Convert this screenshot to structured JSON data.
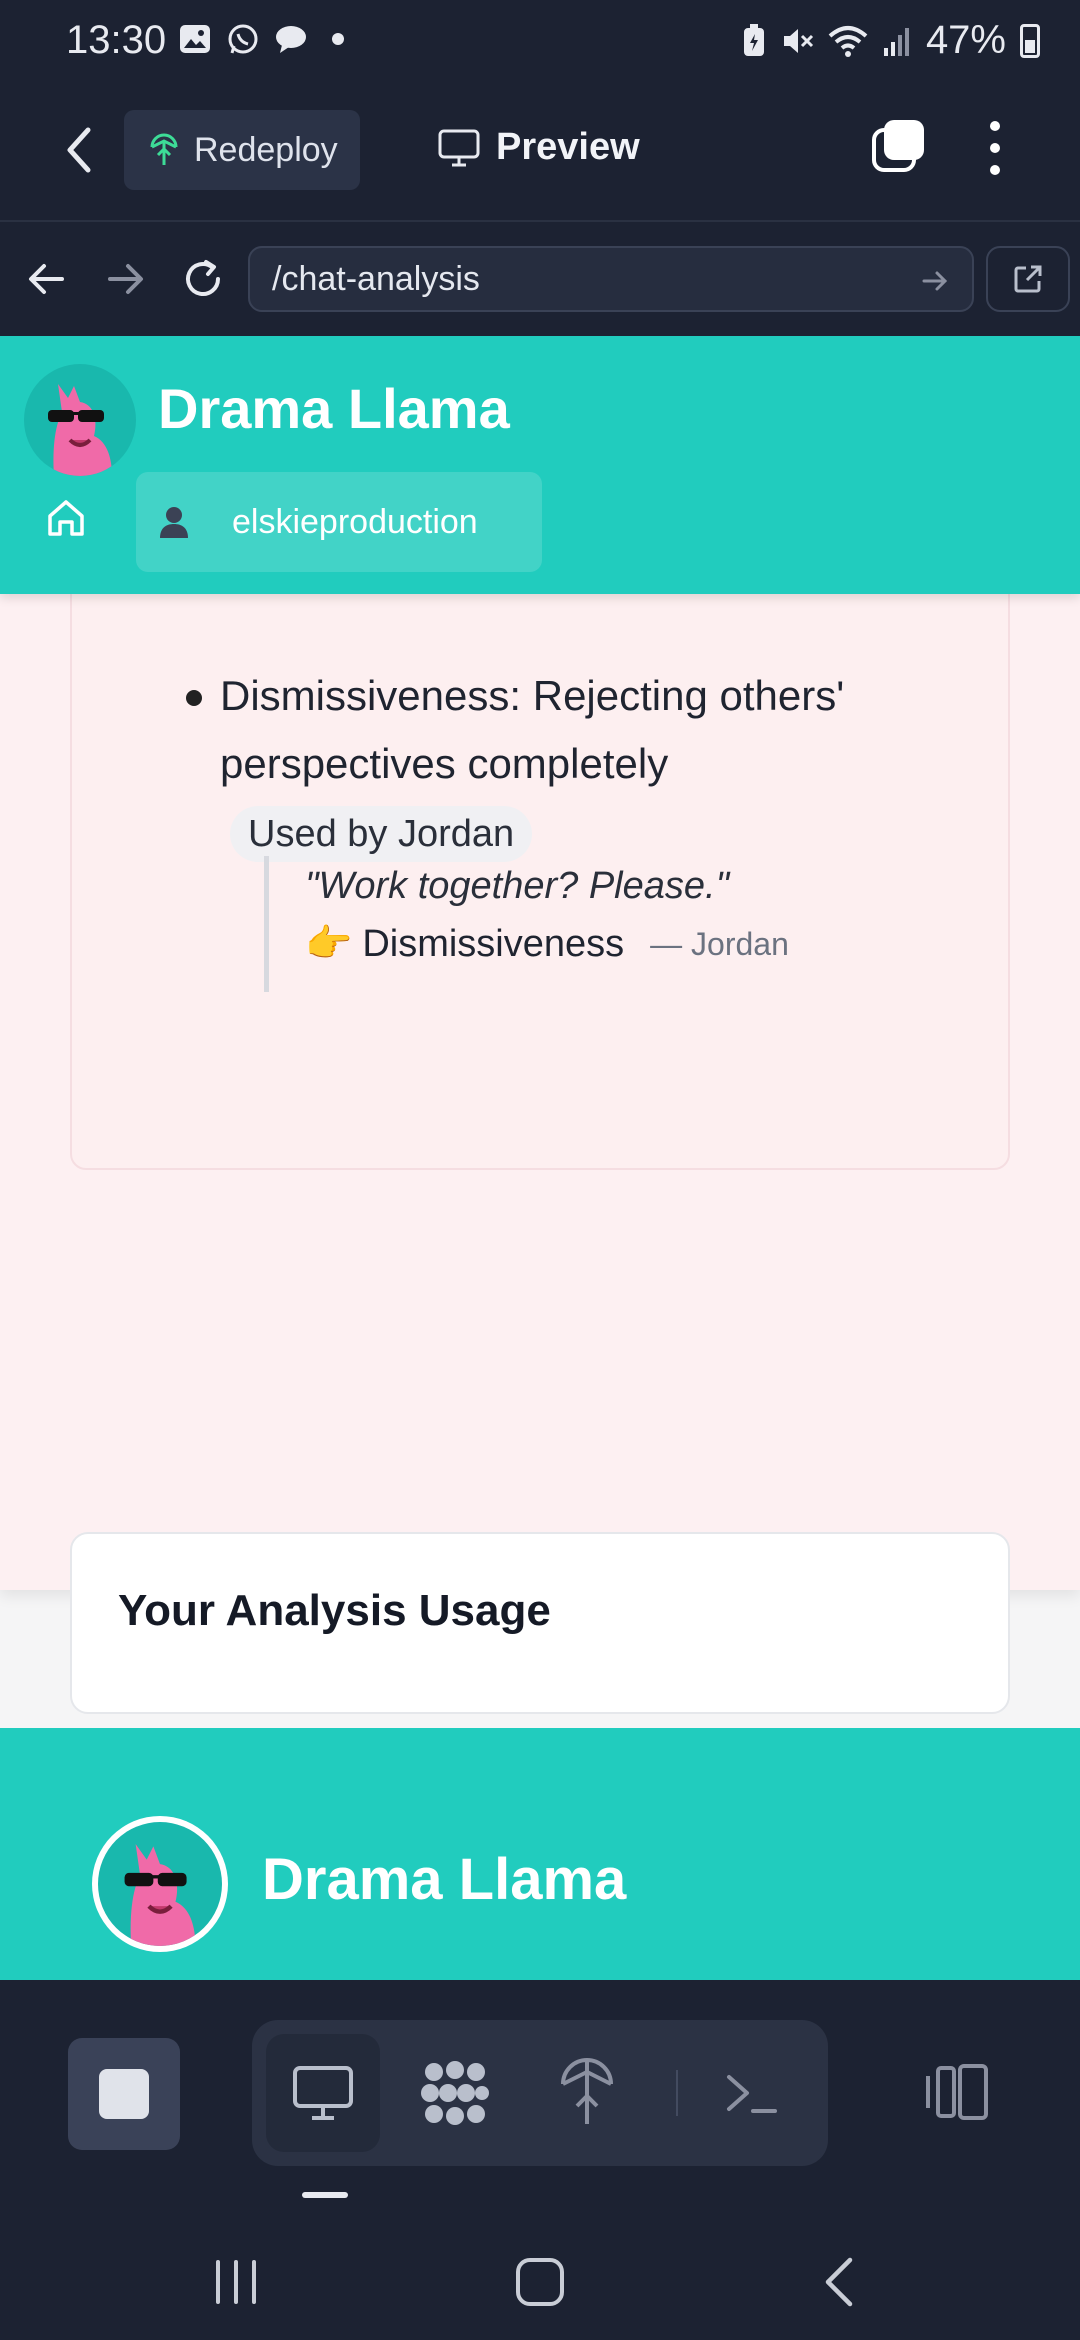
{
  "status_bar": {
    "time": "13:30",
    "battery_percent": "47%",
    "icons": [
      "gallery-icon",
      "whatsapp-icon",
      "chat-bubble-icon",
      "dot-icon",
      "battery-saver-icon",
      "mute-icon",
      "wifi-icon",
      "signal-icon",
      "battery-icon"
    ]
  },
  "toolbar": {
    "redeploy_label": "Redeploy",
    "preview_label": "Preview"
  },
  "browser": {
    "url": "/chat-analysis"
  },
  "site": {
    "title": "Drama Llama",
    "username": "elskieproduction",
    "accent": "#21ccbe"
  },
  "analysis": {
    "item": {
      "term": "Dismissiveness:",
      "description": "Rejecting others' perspectives completely",
      "badge": "Used by Jordan"
    },
    "quote": {
      "text": "\"Work together? Please.\"",
      "emoji": "👉",
      "tag": "Dismissiveness",
      "author": "— Jordan"
    }
  },
  "usage": {
    "title": "Your Analysis Usage"
  },
  "footer": {
    "title": "Drama Llama"
  }
}
